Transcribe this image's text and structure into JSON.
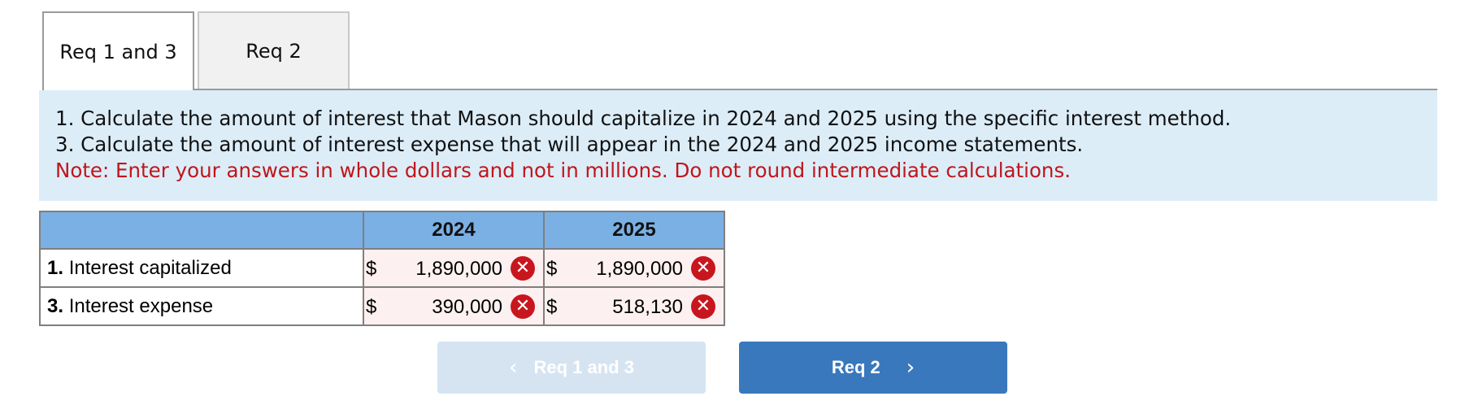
{
  "tabs": [
    {
      "label": "Req 1 and 3",
      "active": true
    },
    {
      "label": "Req 2",
      "active": false
    }
  ],
  "instructions": {
    "line1": "1. Calculate the amount of interest that Mason should capitalize in 2024 and 2025 using the specific interest method.",
    "line2": "3. Calculate the amount of interest expense that will appear in the 2024 and 2025 income statements.",
    "note": "Note: Enter your answers in whole dollars and not in millions. Do not round intermediate calculations."
  },
  "table": {
    "columns": [
      "2024",
      "2025"
    ],
    "rows": [
      {
        "num": "1.",
        "label": "Interest capitalized",
        "values": [
          {
            "currency": "$",
            "value": "1,890,000",
            "status": "incorrect"
          },
          {
            "currency": "$",
            "value": "1,890,000",
            "status": "incorrect"
          }
        ]
      },
      {
        "num": "3.",
        "label": "Interest expense",
        "values": [
          {
            "currency": "$",
            "value": "390,000",
            "status": "incorrect"
          },
          {
            "currency": "$",
            "value": "518,130",
            "status": "incorrect"
          }
        ]
      }
    ],
    "incorrect_icon": "x-mark-icon",
    "colors": {
      "header": "#7ab0e3",
      "incorrect_badge": "#c8161e",
      "cell_bg": "#fdf0f0"
    }
  },
  "nav": {
    "prev_label": "Req 1 and 3",
    "prev_icon": "chevron-left-icon",
    "prev_disabled": true,
    "next_label": "Req 2",
    "next_icon": "chevron-right-icon"
  },
  "colors": {
    "instructions_bg": "#dcedf8",
    "note_text": "#c0161b",
    "next_button": "#3978bd",
    "prev_button_disabled": "#d6e4f2"
  }
}
